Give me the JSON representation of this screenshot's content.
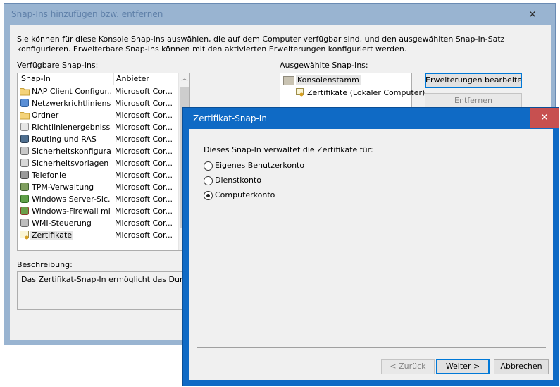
{
  "main_window": {
    "title": "Snap-Ins hinzufügen bzw. entfernen",
    "close_glyph": "✕",
    "intro_line1": "Sie können für diese Konsole Snap-Ins auswählen, die auf dem Computer verfügbar sind, und den ausgewählten Snap-In-Satz",
    "intro_line2": "konfigurieren. Erweiterbare Snap-Ins können mit den aktivierten Erweiterungen konfiguriert werden.",
    "available_label": "Verfügbare Snap-Ins:",
    "selected_label": "Ausgewählte Snap-Ins:",
    "col_snapin": "Snap-In",
    "col_vendor": "Anbieter",
    "scroll_up": "︿",
    "scroll_down": "﹀",
    "available": [
      {
        "name": "NAP Client Configur...",
        "vendor": "Microsoft Cor...",
        "icon": "folder-icon"
      },
      {
        "name": "Netzwerkrichtliniens...",
        "vendor": "Microsoft Cor...",
        "icon": "network-policy-icon"
      },
      {
        "name": "Ordner",
        "vendor": "Microsoft Cor...",
        "icon": "folder-icon"
      },
      {
        "name": "Richtlinienergebnissatz",
        "vendor": "Microsoft Cor...",
        "icon": "policy-result-icon"
      },
      {
        "name": "Routing und RAS",
        "vendor": "Microsoft Cor...",
        "icon": "routing-icon"
      },
      {
        "name": "Sicherheitskonfigura...",
        "vendor": "Microsoft Cor...",
        "icon": "security-config-icon"
      },
      {
        "name": "Sicherheitsvorlagen",
        "vendor": "Microsoft Cor...",
        "icon": "security-templates-icon"
      },
      {
        "name": "Telefonie",
        "vendor": "Microsoft Cor...",
        "icon": "telephony-icon"
      },
      {
        "name": "TPM-Verwaltung",
        "vendor": "Microsoft Cor...",
        "icon": "tpm-icon"
      },
      {
        "name": "Windows Server-Sic...",
        "vendor": "Microsoft Cor...",
        "icon": "windows-server-backup-icon"
      },
      {
        "name": "Windows-Firewall mi...",
        "vendor": "Microsoft Cor...",
        "icon": "firewall-icon"
      },
      {
        "name": "WMI-Steuerung",
        "vendor": "Microsoft Cor...",
        "icon": "wmi-icon"
      },
      {
        "name": "Zertifikate",
        "vendor": "Microsoft Cor...",
        "icon": "certificate-icon"
      }
    ],
    "selected_tree": {
      "root": "Konsolenstamm",
      "child": "Zertifikate (Lokaler Computer)"
    },
    "btn_edit_extensions": "Erweiterungen bearbeiten...",
    "btn_remove": "Entfernen",
    "description_label": "Beschreibung:",
    "description_text": "Das Zertifikat-Snap-In ermöglicht das Durchsuchen"
  },
  "dialog": {
    "title": "Zertifikat-Snap-In",
    "close_glyph": "✕",
    "prompt": "Dieses Snap-In verwaltet die Zertifikate für:",
    "options": [
      {
        "label": "Eigenes Benutzerkonto",
        "checked": false
      },
      {
        "label": "Dienstkonto",
        "checked": false
      },
      {
        "label": "Computerkonto",
        "checked": true
      }
    ],
    "btn_back": "< Zurück",
    "btn_next": "Weiter >",
    "btn_cancel": "Abbrechen"
  },
  "colors": {
    "dialog_frame": "#0f6ac5",
    "close_red": "#c75050",
    "main_frame": "#99b4d1"
  }
}
